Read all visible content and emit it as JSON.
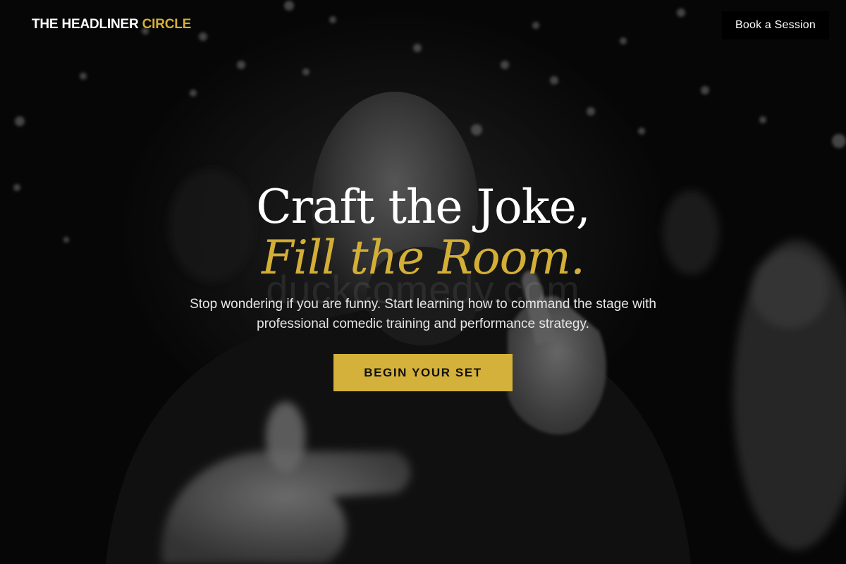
{
  "header": {
    "brand_main": "THE HEADLINER",
    "brand_accent": "CIRCLE",
    "book_button_label": "Book a Session"
  },
  "hero": {
    "title_line1": "Craft the Joke,",
    "title_line2": "Fill the Room.",
    "watermark": "duckcomedy.com",
    "subtitle": "Stop wondering if you are funny. Start learning how to command the stage with professional comedic training and performance strategy.",
    "cta_label": "BEGIN YOUR SET",
    "background_image": "comedian pointing at camera, black and white photo"
  },
  "colors": {
    "accent_gold": "#d4af37",
    "cta_background": "#d4b13a",
    "page_background": "#0a0a0a"
  }
}
